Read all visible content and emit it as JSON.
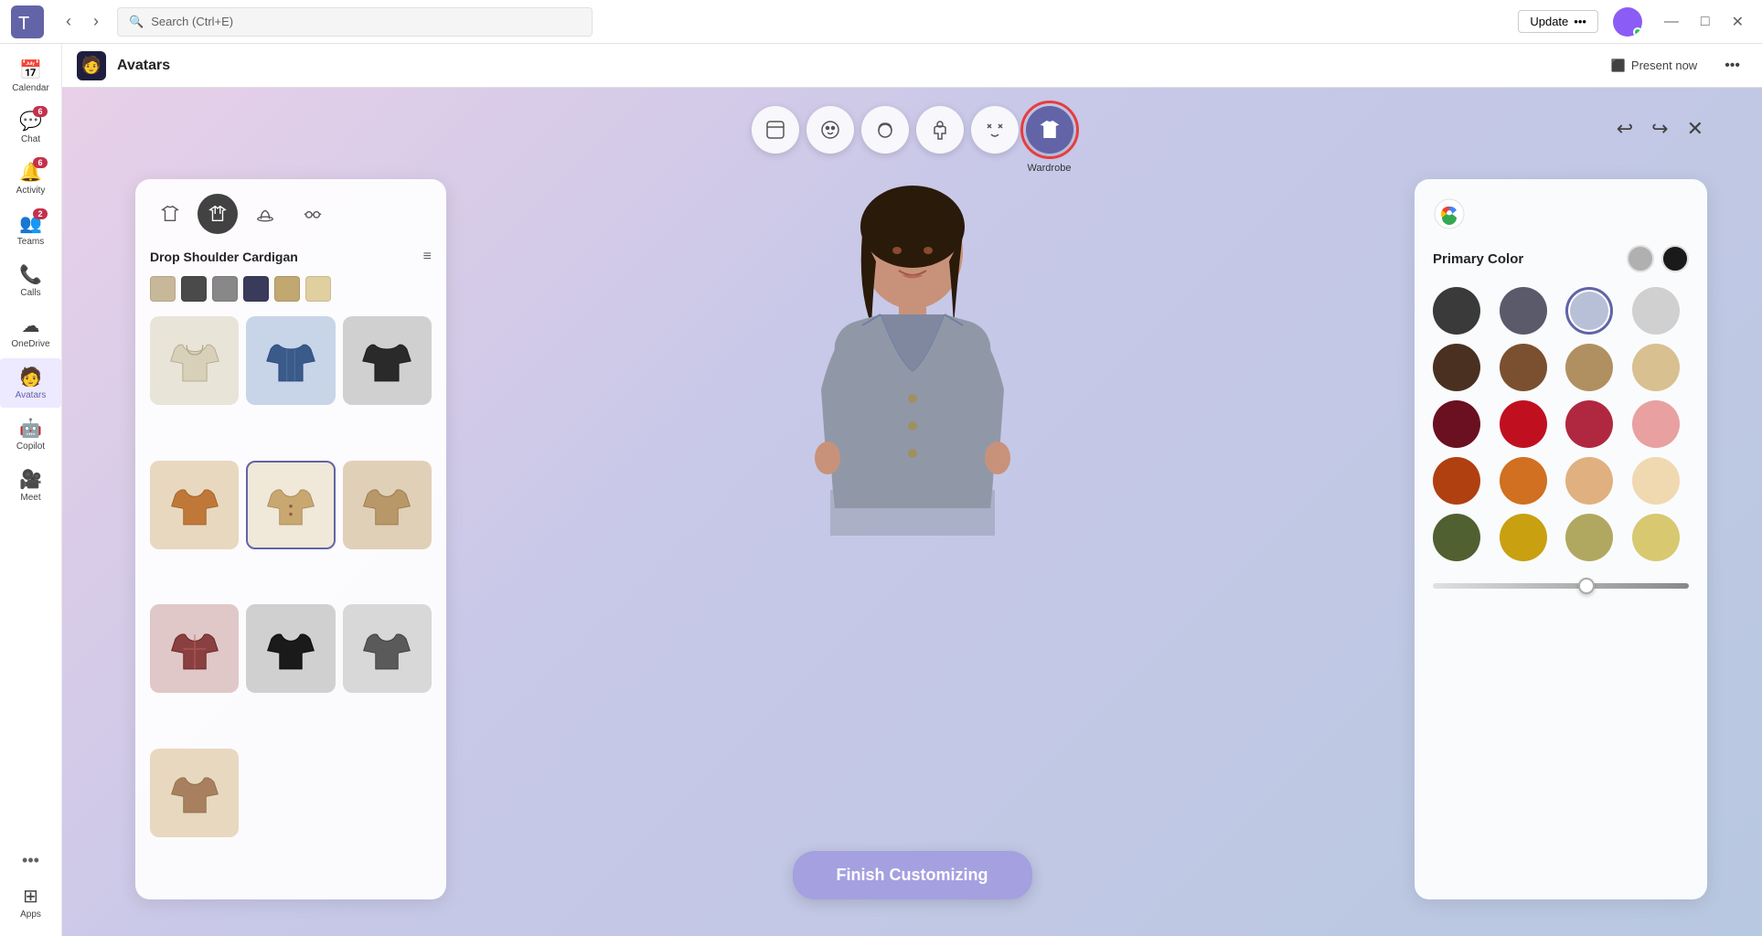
{
  "titlebar": {
    "search_placeholder": "Search (Ctrl+E)",
    "update_label": "Update",
    "update_dots": "•••",
    "min_btn": "—",
    "max_btn": "□",
    "close_btn": "✕"
  },
  "sidebar": {
    "items": [
      {
        "id": "calendar",
        "label": "Calendar",
        "icon": "📅",
        "badge": null,
        "active": false
      },
      {
        "id": "chat",
        "label": "Chat",
        "icon": "💬",
        "badge": "6",
        "active": false
      },
      {
        "id": "activity",
        "label": "Activity",
        "icon": "🔔",
        "badge": "6",
        "active": false
      },
      {
        "id": "teams",
        "label": "Teams",
        "icon": "👥",
        "badge": "2",
        "active": false
      },
      {
        "id": "calls",
        "label": "Calls",
        "icon": "📞",
        "badge": null,
        "active": false
      },
      {
        "id": "onedrive",
        "label": "OneDrive",
        "icon": "☁",
        "badge": null,
        "active": false
      },
      {
        "id": "avatars",
        "label": "Avatars",
        "icon": "🧑",
        "badge": null,
        "active": true
      },
      {
        "id": "copilot",
        "label": "Copilot",
        "icon": "🤖",
        "badge": null,
        "active": false
      },
      {
        "id": "meet",
        "label": "Meet",
        "icon": "🎥",
        "badge": null,
        "active": false
      },
      {
        "id": "apps",
        "label": "Apps",
        "icon": "⊞",
        "badge": null,
        "active": false
      }
    ],
    "more_label": "•••"
  },
  "app_header": {
    "icon": "🧑",
    "title": "Avatars",
    "present_label": "Present now",
    "more_dots": "•••"
  },
  "toolbar": {
    "buttons": [
      {
        "id": "avatar-base",
        "icon": "🖼",
        "label": "",
        "active": false
      },
      {
        "id": "face",
        "icon": "😊",
        "label": "",
        "active": false
      },
      {
        "id": "hair",
        "icon": "👤",
        "label": "",
        "active": false
      },
      {
        "id": "body",
        "icon": "🧍",
        "label": "",
        "active": false
      },
      {
        "id": "expression",
        "icon": "🎭",
        "label": "",
        "active": false
      },
      {
        "id": "wardrobe",
        "icon": "👕",
        "label": "Wardrobe",
        "active": true
      }
    ],
    "undo_icon": "↩",
    "redo_icon": "↪",
    "close_icon": "✕"
  },
  "wardrobe_panel": {
    "tabs": [
      {
        "id": "shirt",
        "icon": "👕",
        "active": false
      },
      {
        "id": "jacket",
        "icon": "🧥",
        "active": true
      },
      {
        "id": "hat",
        "icon": "🎩",
        "active": false
      },
      {
        "id": "glasses",
        "icon": "👓",
        "active": false
      }
    ],
    "title": "Drop Shoulder Cardigan",
    "filter_icon": "≡",
    "color_chips": [
      "#c8b89a",
      "#4a4a4a",
      "#888888",
      "#3a3a5a",
      "#c0a870",
      "#e0d0a0"
    ],
    "items": [
      {
        "id": "hoodie-beige",
        "emoji": "🧥",
        "bg": "#e8e0d0",
        "selected": false
      },
      {
        "id": "jacket-blue",
        "emoji": "🧥",
        "bg": "#3a5a8a",
        "selected": false
      },
      {
        "id": "jacket-black",
        "emoji": "🧥",
        "bg": "#2a2a2a",
        "selected": false
      },
      {
        "id": "cardigan-orange",
        "emoji": "🧥",
        "bg": "#c87840",
        "selected": false
      },
      {
        "id": "cardigan-beige-selected",
        "emoji": "🧥",
        "bg": "#c8a870",
        "selected": true
      },
      {
        "id": "jacket-tan",
        "emoji": "🧥",
        "bg": "#b8986a",
        "selected": false
      },
      {
        "id": "jacket-plaid",
        "emoji": "🧥",
        "bg": "#8a4040",
        "selected": false
      },
      {
        "id": "jacket-black2",
        "emoji": "🧥",
        "bg": "#1a1a1a",
        "selected": false
      },
      {
        "id": "jacket-grey",
        "emoji": "🧥",
        "bg": "#5a5a5a",
        "selected": false
      },
      {
        "id": "jacket-tan2",
        "emoji": "🧥",
        "bg": "#a88060",
        "selected": false
      }
    ]
  },
  "color_panel": {
    "primary_color_label": "Primary Color",
    "primary_swatches": [
      "#b0b0b0",
      "#1a1a1a"
    ],
    "colors": [
      {
        "id": "dark-grey",
        "hex": "#3a3a3a",
        "selected": false
      },
      {
        "id": "medium-grey",
        "hex": "#5a5a6a",
        "selected": false
      },
      {
        "id": "light-blue-grey",
        "hex": "#b8c0d8",
        "selected": true
      },
      {
        "id": "light-grey",
        "hex": "#d0d0d0",
        "selected": false
      },
      {
        "id": "dark-brown",
        "hex": "#4a3020",
        "selected": false
      },
      {
        "id": "medium-brown",
        "hex": "#7a5030",
        "selected": false
      },
      {
        "id": "tan",
        "hex": "#b09060",
        "selected": false
      },
      {
        "id": "light-tan",
        "hex": "#d8c090",
        "selected": false
      },
      {
        "id": "dark-red",
        "hex": "#6a1020",
        "selected": false
      },
      {
        "id": "red",
        "hex": "#c01020",
        "selected": false
      },
      {
        "id": "crimson",
        "hex": "#b02840",
        "selected": false
      },
      {
        "id": "pink",
        "hex": "#e8a0a0",
        "selected": false
      },
      {
        "id": "orange",
        "hex": "#b04010",
        "selected": false
      },
      {
        "id": "amber",
        "hex": "#d07020",
        "selected": false
      },
      {
        "id": "peach",
        "hex": "#e0b080",
        "selected": false
      },
      {
        "id": "cream",
        "hex": "#f0d8b0",
        "selected": false
      },
      {
        "id": "olive",
        "hex": "#506030",
        "selected": false
      },
      {
        "id": "yellow",
        "hex": "#c8a010",
        "selected": false
      },
      {
        "id": "khaki",
        "hex": "#b0a860",
        "selected": false
      },
      {
        "id": "pale-yellow",
        "hex": "#d8c870",
        "selected": false
      }
    ],
    "slider_value": 60
  },
  "finish_btn": {
    "label": "Finish Customizing"
  }
}
